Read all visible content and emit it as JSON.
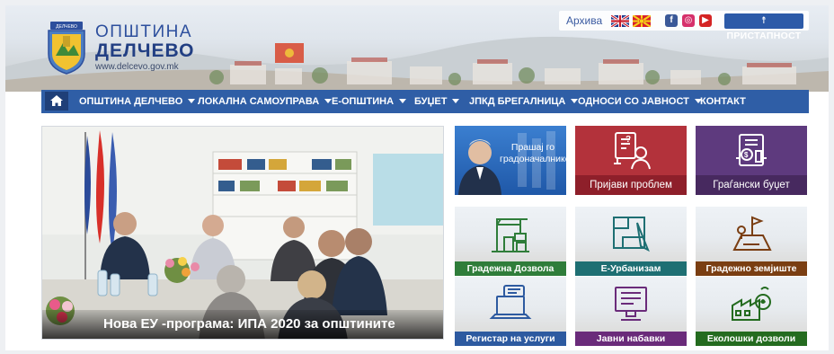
{
  "header": {
    "title": "ОПШТИНА",
    "subtitle": "ДЕЛЧЕВО",
    "url": "www.delcevo.gov.mk",
    "crest_label": "ДЕЛЧЕВО"
  },
  "topbar": {
    "archive": "Архива",
    "accessibility": "ПРИСТАПНОСТ",
    "social": [
      "f",
      "◎",
      "▶"
    ]
  },
  "nav": {
    "items": [
      {
        "label": "ОПШТИНА ДЕЛЧЕВО",
        "dropdown": true
      },
      {
        "label": "ЛОКАЛНА САМОУПРАВА",
        "dropdown": true
      },
      {
        "label": "Е-ОПШТИНА",
        "dropdown": true
      },
      {
        "label": "БУЏЕТ",
        "dropdown": true
      },
      {
        "label": "ЈПКД БРЕГАЛНИЦА",
        "dropdown": true
      },
      {
        "label": "ОДНОСИ СО ЈАВНОСТ",
        "dropdown": true
      },
      {
        "label": "КОНТАКТ",
        "dropdown": false
      }
    ]
  },
  "hero": {
    "caption": "Нова ЕУ -програма: ИПА 2020 за општините"
  },
  "tiles": {
    "mayor": {
      "label": "Прашај го градоначалникот"
    },
    "report": {
      "label": "Пријави проблем"
    },
    "budget": {
      "label": "Граѓански буџет"
    },
    "permit": {
      "label": "Градежна Дозвола"
    },
    "urbanism": {
      "label": "Е-Урбанизам"
    },
    "land": {
      "label": "Градежно земјиште"
    },
    "services": {
      "label": "Регистар на услуги"
    },
    "procurement": {
      "label": "Јавни набавки"
    },
    "eco": {
      "label": "Еколошки дозволи"
    }
  },
  "colors": {
    "nav": "#2f5ea6",
    "report": "#b3323b",
    "budget": "#5e3a7e",
    "green": "#2f7d3a",
    "teal": "#1e6f73",
    "brown": "#7a3e12",
    "blue": "#2d5aa0",
    "purple": "#6a2b7a",
    "dkgreen": "#246b1f"
  }
}
